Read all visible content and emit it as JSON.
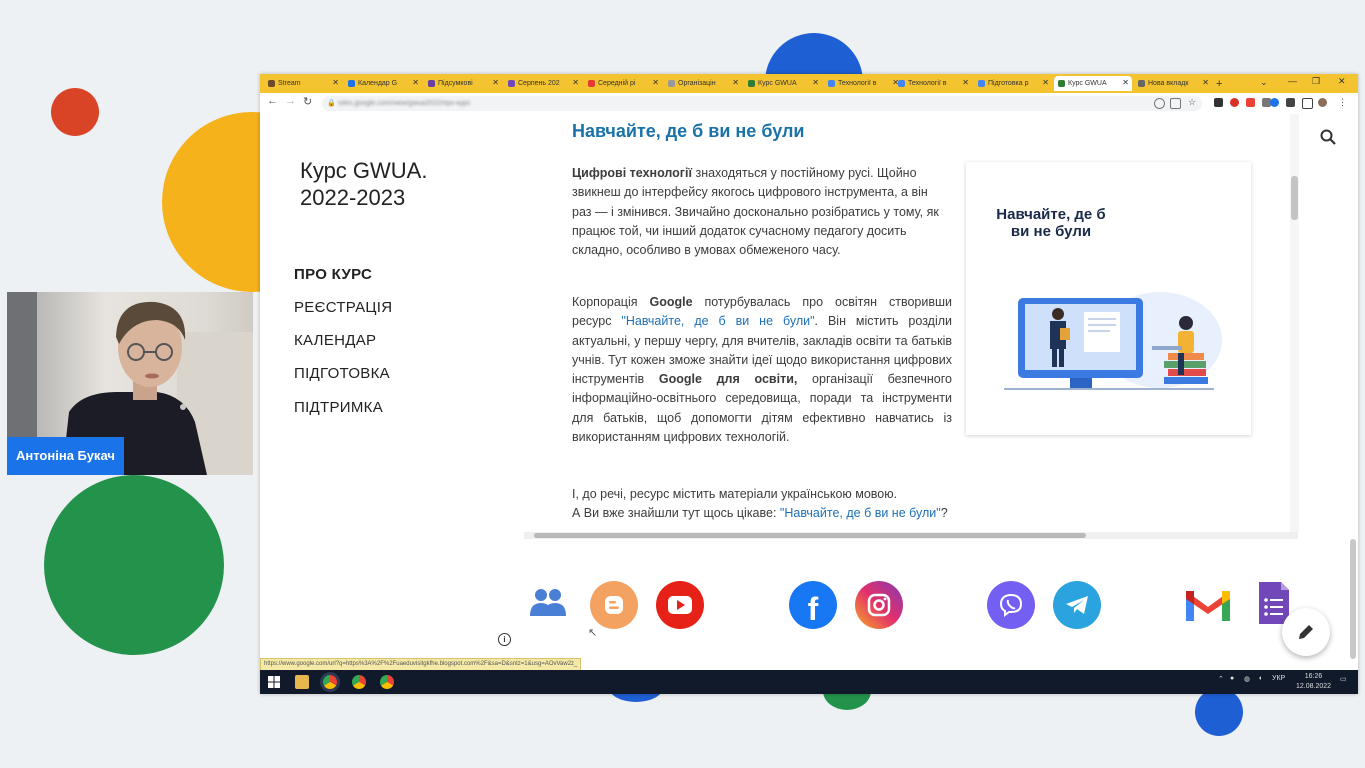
{
  "browser": {
    "tabs": [
      {
        "label": "Stream",
        "color": "#6b4b2a"
      },
      {
        "label": "Календар G",
        "color": "#1a73e8"
      },
      {
        "label": "Підсумкові",
        "color": "#6b3fa0"
      },
      {
        "label": "Серпень 202",
        "color": "#7248b9"
      },
      {
        "label": "Середній рі",
        "color": "#e53935"
      },
      {
        "label": "Організацін",
        "color": "#999999"
      },
      {
        "label": "Курс GWUA",
        "color": "#2e7d32"
      },
      {
        "label": "Технології в",
        "color": "#4285f4"
      },
      {
        "label": "Технології в",
        "color": "#4285f4"
      },
      {
        "label": "Підготовка р",
        "color": "#4285f4"
      },
      {
        "label": "Курс GWUA",
        "color": "#2e7d32"
      },
      {
        "label": "Нова вкладк",
        "color": "#666666"
      }
    ],
    "new_tab_label": "+",
    "url": "sites.google.com/view/gwua2022/про-курс"
  },
  "site": {
    "title": "Курс GWUA. 2022-2023",
    "nav": [
      "ПРО КУРС",
      "РЕЄСТРАЦІЯ",
      "КАЛЕНДАР",
      "ПІДГОТОВКА",
      "ПІДТРИМКА"
    ]
  },
  "article": {
    "heading": "Навчайте, де б ви не були",
    "p1_bold": "Цифрові технології",
    "p1_text": " знаходяться у постійному русі. Щойно звикнеш до інтерфейсу якогось цифрового інструмента, а він раз — і змінився. Звичайно досконально розібратись у тому, як працює той, чи інший додаток сучасному педагогу досить складно, особливо в умовах обмеженого часу.",
    "p2_a": "Корпорація ",
    "p2_bold1": "Google",
    "p2_b": " потурбувалась про освітян створивши ресурс ",
    "p2_link": "\"Навчайте, де б ви не були\"",
    "p2_c": ". Він містить розділи актуальні, у першу чергу, для вчителів, закладів освіти та батьків учнів. Тут кожен зможе знайти ідеї щодо використання цифрових інструментів ",
    "p2_bold2": "Google для освіти,",
    "p2_d": " організації безпечного інформаційно-освітнього середовища, поради та інструменти для батьків, щоб допомогти дітям ефективно навчатись із використанням цифрових технологій.",
    "p3": "І, до речі, ресурс містить матеріали українською мовою.",
    "p4_a": "А Ви вже знайшли тут щось цікаве: ",
    "p4_link": "\"Навчайте, де б ви не були\"",
    "p4_b": "?",
    "promo_title": "Навчайте, де б ви не були"
  },
  "status_url": "https://www.google.com/url?q=https%3A%2F%2Fuaeduvisitgkfhe.blogspot.com%2F&sa=D&sntz=1&usg=AOvVaw2z_",
  "taskbar": {
    "lang": "УКР",
    "time": "16:26",
    "date": "12.08.2022"
  },
  "webcam": {
    "name": "Антоніна Букач"
  },
  "colors": {
    "tabbar": "#f4c430",
    "link": "#1e6fb8",
    "heading": "#1a73a8"
  }
}
